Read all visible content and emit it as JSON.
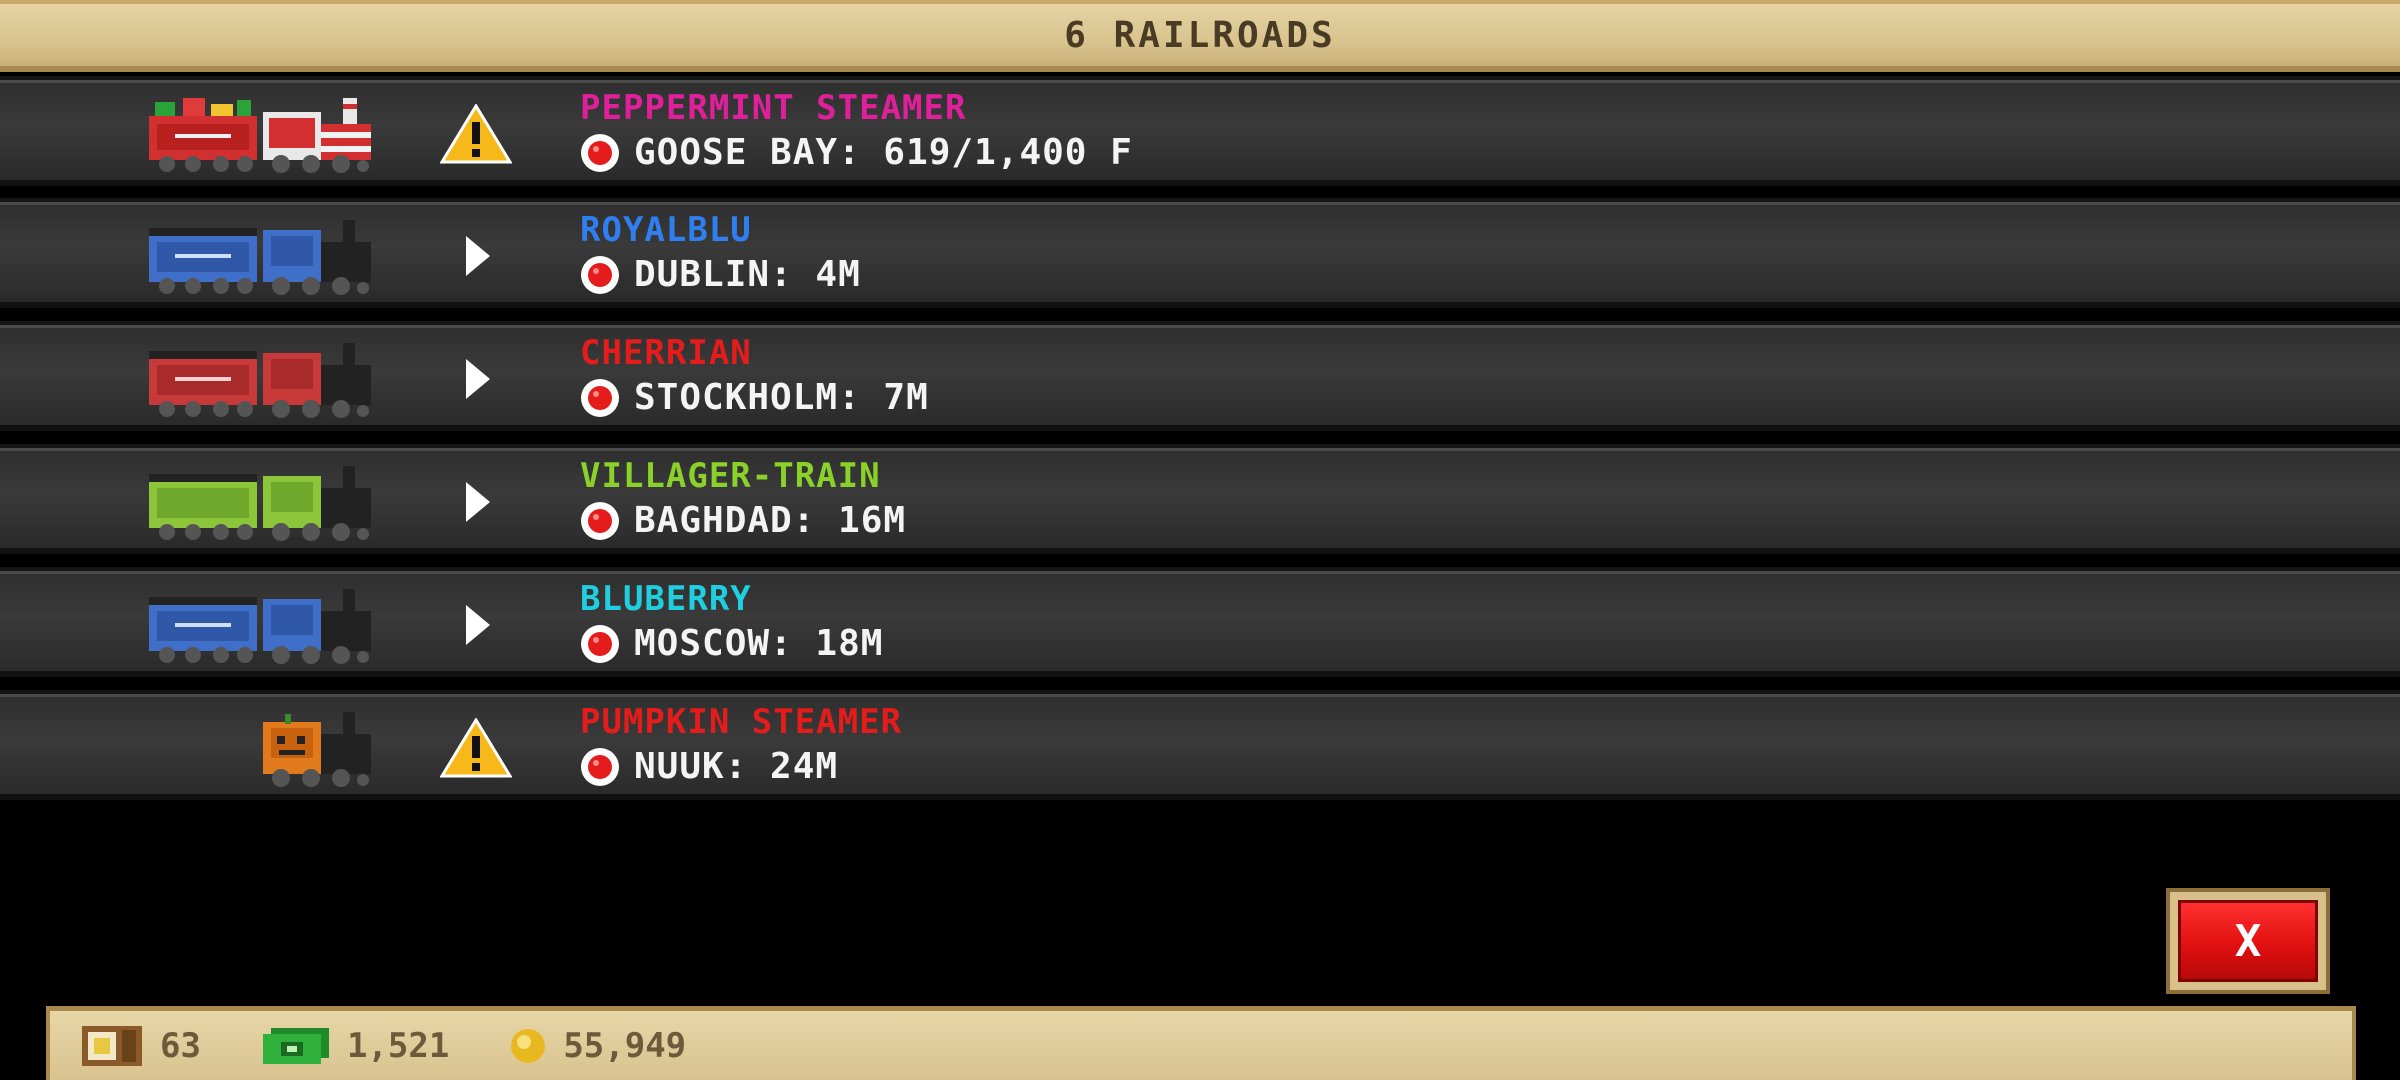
{
  "header": {
    "title": "6 RAILROADS"
  },
  "trains": [
    {
      "name": "PEPPERMINT STEAMER",
      "route": "GOOSE BAY: 619/1,400 F",
      "name_color": "#e0209a",
      "status_icon": "warning-icon",
      "livery": "peppermint"
    },
    {
      "name": "ROYALBLU",
      "route": "DUBLIN: 4M",
      "name_color": "#2f7ff0",
      "status_icon": "play-arrow-icon",
      "livery": "blue"
    },
    {
      "name": "CHERRIAN",
      "route": "STOCKHOLM: 7M",
      "name_color": "#e41c1c",
      "status_icon": "play-arrow-icon",
      "livery": "red"
    },
    {
      "name": "VILLAGER-TRAIN",
      "route": "BAGHDAD: 16M",
      "name_color": "#8ad12a",
      "status_icon": "play-arrow-icon",
      "livery": "green"
    },
    {
      "name": "BLUBERRY",
      "route": "MOSCOW: 18M",
      "name_color": "#1fcfe0",
      "status_icon": "play-arrow-icon",
      "livery": "blue"
    },
    {
      "name": "PUMPKIN STEAMER",
      "route": "NUUK: 24M",
      "name_color": "#e41c1c",
      "status_icon": "warning-icon",
      "livery": "pumpkin"
    }
  ],
  "close_button": {
    "label": "X"
  },
  "footer": {
    "crates": "63",
    "cash": "1,521",
    "coins": "55,949"
  },
  "colors": {
    "header_bg": "#d9c48f",
    "row_bg": "#333333",
    "warning": "#f7b81a",
    "close_red": "#e01010"
  }
}
